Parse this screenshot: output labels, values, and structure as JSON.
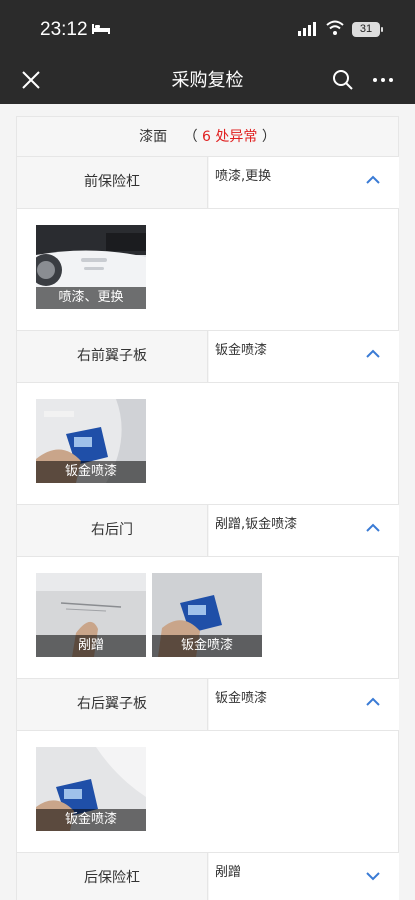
{
  "status": {
    "time": "23:12",
    "battery": "31"
  },
  "nav": {
    "title": "采购复检"
  },
  "section": {
    "label": "漆面",
    "open_paren": "（",
    "count_text": "6 处异常",
    "close_paren": "）"
  },
  "items": [
    {
      "name": "前保险杠",
      "value": "喷漆,更换",
      "expanded": true,
      "photos": [
        {
          "caption": "喷漆、更换"
        }
      ]
    },
    {
      "name": "右前翼子板",
      "value": "钣金喷漆",
      "expanded": true,
      "photos": [
        {
          "caption": "钣金喷漆"
        }
      ]
    },
    {
      "name": "右后门",
      "value": "剐蹭,钣金喷漆",
      "expanded": true,
      "photos": [
        {
          "caption": "剐蹭"
        },
        {
          "caption": "钣金喷漆"
        }
      ]
    },
    {
      "name": "右后翼子板",
      "value": "钣金喷漆",
      "expanded": true,
      "photos": [
        {
          "caption": "钣金喷漆"
        }
      ]
    },
    {
      "name": "后保险杠",
      "value": "剐蹭",
      "expanded": false
    }
  ],
  "colors": {
    "bar_bg": "#2b2b2b",
    "accent_blue": "#3a7bd5",
    "alert_red": "#e02020"
  }
}
